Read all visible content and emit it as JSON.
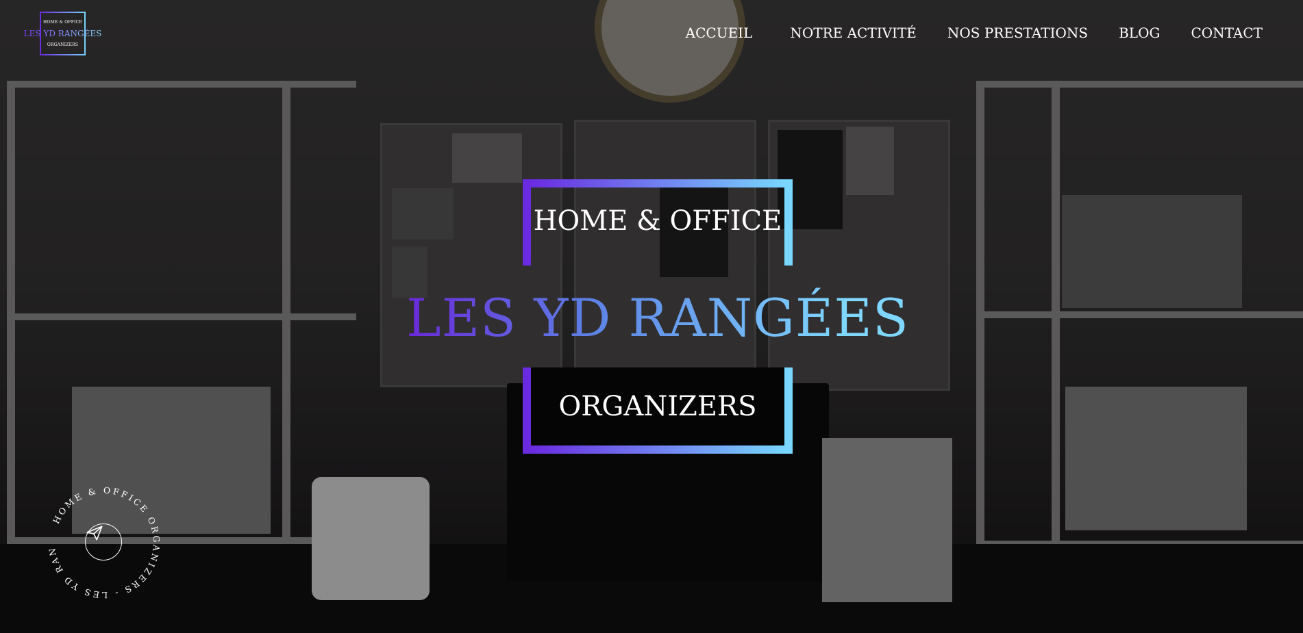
{
  "logo": {
    "top": "HOME & OFFICE",
    "middle": "LES YD RANGÉES",
    "bottom": "ORGANIZERS"
  },
  "nav": {
    "items": [
      {
        "label": "ACCUEIL"
      },
      {
        "label": "NOTRE ACTIVITÉ"
      },
      {
        "label": "NOS PRESTATIONS"
      },
      {
        "label": "BLOG"
      },
      {
        "label": "CONTACT"
      }
    ]
  },
  "hero": {
    "line_top": "HOME & OFFICE",
    "title": "LES YD RANGÉES",
    "line_bottom": "ORGANIZERS"
  },
  "badge": {
    "circle_text": "HOME & OFFICE ORGANIZERS - LES YD RANGÉES - ",
    "icon": "paper-plane-icon"
  },
  "colors": {
    "gradient_start": "#6a2be0",
    "gradient_end": "#79d3ff",
    "text": "#ffffff"
  }
}
